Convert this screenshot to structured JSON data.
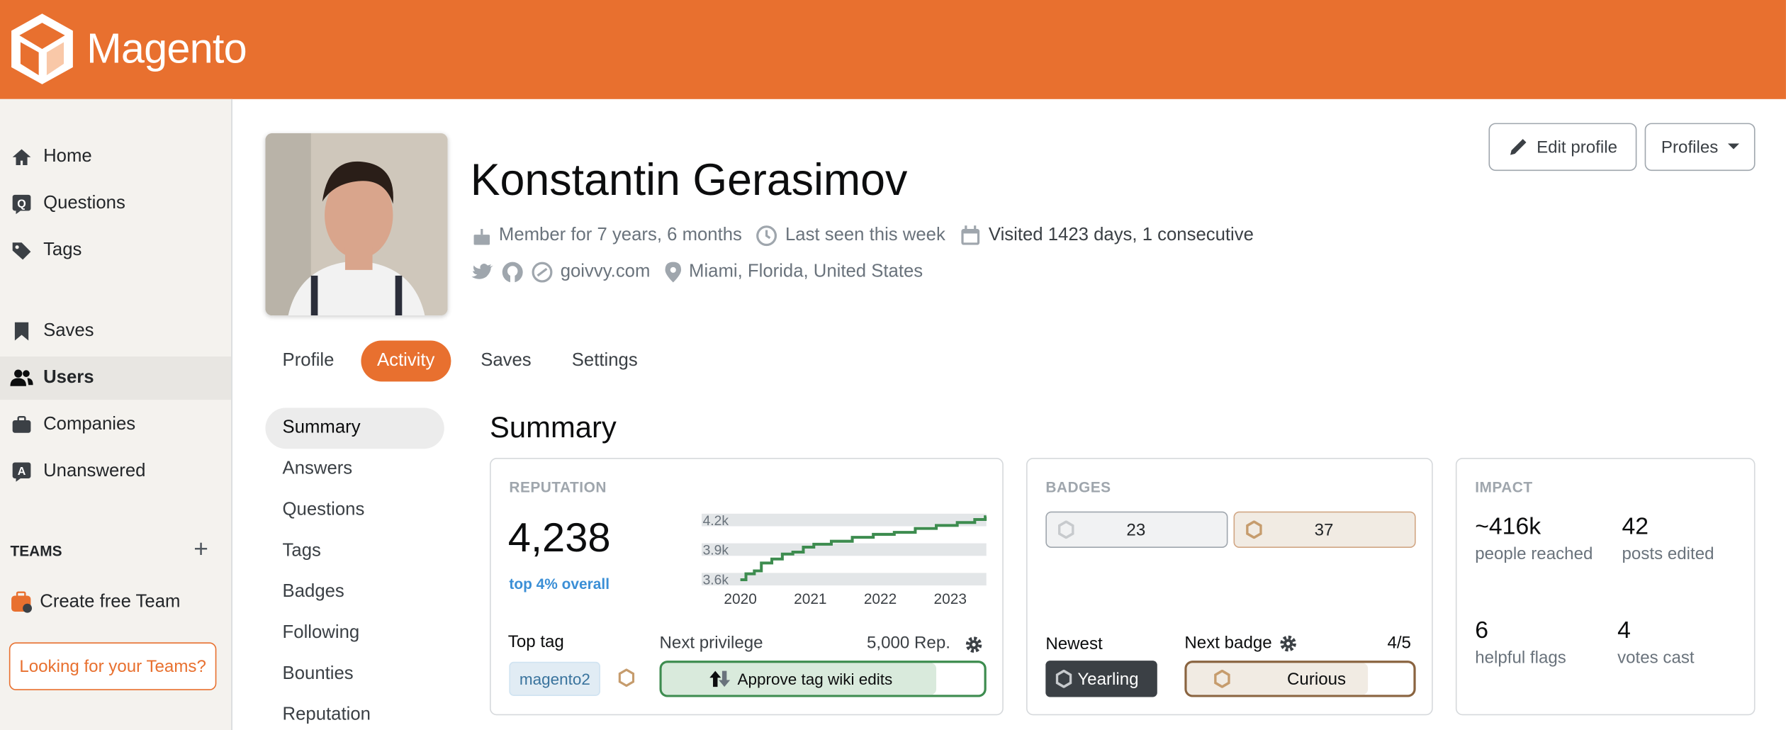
{
  "brand": {
    "name": "Magento",
    "color": "#e8702f"
  },
  "sidebar": {
    "items": [
      {
        "label": "Home",
        "icon": "home-icon"
      },
      {
        "label": "Questions",
        "icon": "questions-icon"
      },
      {
        "label": "Tags",
        "icon": "tag-icon"
      },
      {
        "label": "Saves",
        "icon": "bookmark-icon"
      },
      {
        "label": "Users",
        "icon": "users-icon",
        "active": true
      },
      {
        "label": "Companies",
        "icon": "briefcase-icon"
      },
      {
        "label": "Unanswered",
        "icon": "unanswered-icon"
      }
    ],
    "teams_label": "TEAMS",
    "create_team": "Create free Team",
    "looking_teams": "Looking for your Teams?"
  },
  "profile": {
    "name": "Konstantin Gerasimov",
    "member_for": "Member for 7 years, 6 months",
    "last_seen": "Last seen this week",
    "visited": "Visited 1423 days, 1 consecutive",
    "website": "goivvy.com",
    "location": "Miami, Florida, United States",
    "edit_profile": "Edit profile",
    "profiles": "Profiles"
  },
  "tabs": [
    {
      "label": "Profile"
    },
    {
      "label": "Activity",
      "active": true
    },
    {
      "label": "Saves"
    },
    {
      "label": "Settings"
    }
  ],
  "subnav": [
    {
      "label": "Summary",
      "active": true
    },
    {
      "label": "Answers"
    },
    {
      "label": "Questions"
    },
    {
      "label": "Tags"
    },
    {
      "label": "Badges"
    },
    {
      "label": "Following"
    },
    {
      "label": "Bounties"
    },
    {
      "label": "Reputation"
    }
  ],
  "summary": {
    "title": "Summary",
    "reputation": {
      "title": "REPUTATION",
      "value": "4,238",
      "rank": "top 4% overall",
      "top_tag_label": "Top tag",
      "top_tag": "magento2",
      "next_privilege_label": "Next privilege",
      "next_privilege_rep": "5,000 Rep.",
      "next_privilege": "Approve tag wiki edits",
      "privilege_progress": 0.85
    },
    "badges": {
      "title": "BADGES",
      "silver": "23",
      "bronze": "37",
      "newest_label": "Newest",
      "newest": "Yearling",
      "next_badge_label": "Next badge",
      "next_badge": "Curious",
      "next_badge_progress_text": "4/5",
      "next_badge_progress": 0.8
    },
    "impact": {
      "title": "IMPACT",
      "stats": [
        {
          "value": "~416k",
          "label": "people reached"
        },
        {
          "value": "42",
          "label": "posts edited"
        },
        {
          "value": "6",
          "label": "helpful flags"
        },
        {
          "value": "4",
          "label": "votes cast"
        }
      ]
    }
  },
  "chart_data": {
    "type": "line",
    "x_ticks": [
      "2020",
      "2021",
      "2022",
      "2023"
    ],
    "y_ticks": [
      "3.6k",
      "3.9k",
      "4.2k"
    ],
    "y_tick_values": [
      3600,
      3900,
      4200
    ],
    "xlim": [
      2020,
      2023.5
    ],
    "ylim": [
      3600,
      4238
    ],
    "color": "#3d8c4f",
    "grid": "bands",
    "x": [
      2020.0,
      2020.08,
      2020.2,
      2020.3,
      2020.45,
      2020.6,
      2020.75,
      2020.9,
      2021.05,
      2021.3,
      2021.6,
      2021.9,
      2022.2,
      2022.5,
      2022.8,
      2023.1,
      2023.35,
      2023.5
    ],
    "y": [
      3600,
      3660,
      3690,
      3770,
      3810,
      3860,
      3880,
      3930,
      3960,
      3990,
      4030,
      4060,
      4080,
      4120,
      4150,
      4180,
      4210,
      4238
    ]
  }
}
